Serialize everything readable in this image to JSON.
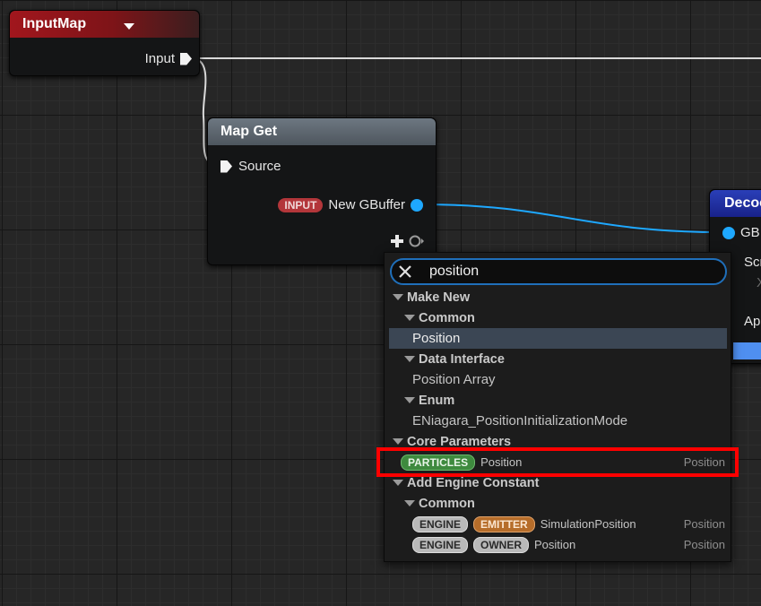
{
  "colors": {
    "inputmap_header": "#a1161d",
    "mapget_header": "#6d7781",
    "decode_header": "#2a3fb8",
    "data_pin": "#1ea8ff",
    "selection": "#3b4654",
    "search_border": "#1f6fba",
    "highlight": "#ff0000"
  },
  "nodes": {
    "input_map": {
      "title": "InputMap",
      "dropdown_icon": "chevron-down-icon",
      "output_pin": "Input"
    },
    "map_get": {
      "title": "Map Get",
      "source_pin": "Source",
      "output_tag": "INPUT",
      "output_pin": "New GBuffer",
      "add_pin_icon": "plus-icon"
    },
    "decode": {
      "title": "Decoc",
      "pins": [
        "GB",
        "Scr",
        "X",
        "Ap"
      ]
    }
  },
  "search": {
    "value": "position",
    "clear_icon": "close-icon",
    "sections": {
      "make_new": "Make New",
      "common": "Common",
      "position": "Position",
      "data_interface": "Data Interface",
      "position_array": "Position Array",
      "enum": "Enum",
      "enum_item": "ENiagara_PositionInitializationMode",
      "core_parameters": "Core Parameters",
      "add_engine_constant": "Add Engine Constant",
      "common2": "Common"
    },
    "core_param": {
      "tag": "PARTICLES",
      "name": "Position",
      "type": "Position"
    },
    "engine_items": [
      {
        "tag1": "ENGINE",
        "tag2": "EMITTER",
        "name": "SimulationPosition",
        "type": "Position"
      },
      {
        "tag1": "ENGINE",
        "tag2": "OWNER",
        "name": "Position",
        "type": "Position"
      }
    ]
  }
}
